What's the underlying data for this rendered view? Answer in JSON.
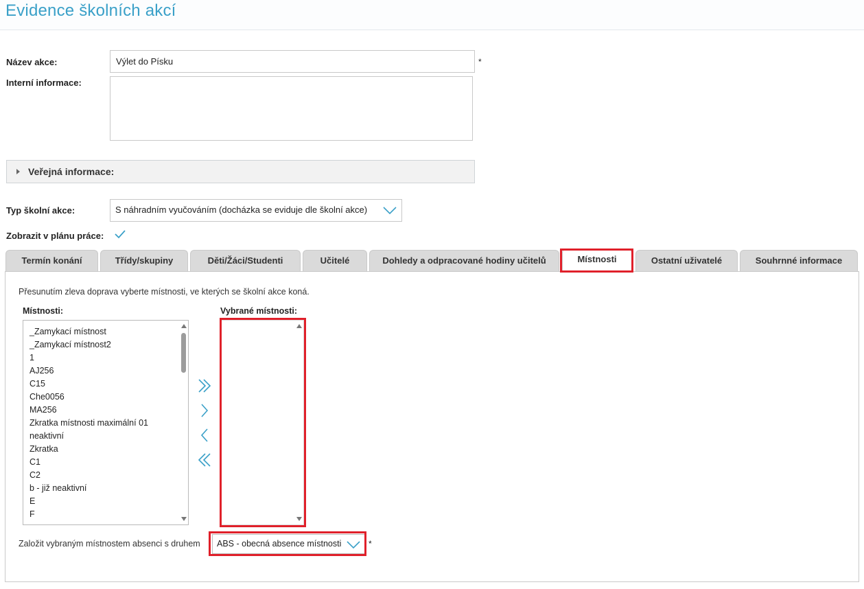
{
  "header": {
    "title": "Evidence školních akcí"
  },
  "form": {
    "name_label": "Název akce:",
    "name_value": "Výlet do Písku",
    "required_mark": "*",
    "internal_label": "Interní informace:",
    "internal_value": "",
    "public_section_label": "Veřejná informace:",
    "type_label": "Typ školní akce:",
    "type_value": "S náhradním vyučováním (docházka se eviduje dle školní akce)",
    "show_in_plan_label": "Zobrazit v plánu práce:"
  },
  "tabs": [
    {
      "label": "Termín konání"
    },
    {
      "label": "Třídy/skupiny"
    },
    {
      "label": "Děti/Žáci/Studenti"
    },
    {
      "label": "Učitelé"
    },
    {
      "label": "Dohledy a odpracované hodiny učitelů"
    },
    {
      "label": "Místnosti"
    },
    {
      "label": "Ostatní uživatelé"
    },
    {
      "label": "Souhrnné informace"
    }
  ],
  "rooms": {
    "hint": "Přesunutím zleva doprava vyberte místnosti, ve kterých se školní akce koná.",
    "available_label": "Místnosti:",
    "selected_label": "Vybrané místnosti:",
    "available": [
      "_Zamykací místnost",
      "_Zamykací místnost2",
      "1",
      "AJ256",
      "C15",
      "Che0056",
      "MA256",
      "Zkratka místnosti maximální 01",
      "neaktivní",
      "Zkratka",
      "C1",
      "C2",
      "b - již neaktivní",
      "E",
      "F"
    ],
    "absence_label": "Založit vybraným místnostem absenci s druhem",
    "absence_value": "ABS - obecná absence místnosti",
    "required_mark": "*"
  },
  "colors": {
    "accent": "#3aa0c8",
    "highlight": "#e0202a",
    "tab_bg": "#dadada"
  }
}
